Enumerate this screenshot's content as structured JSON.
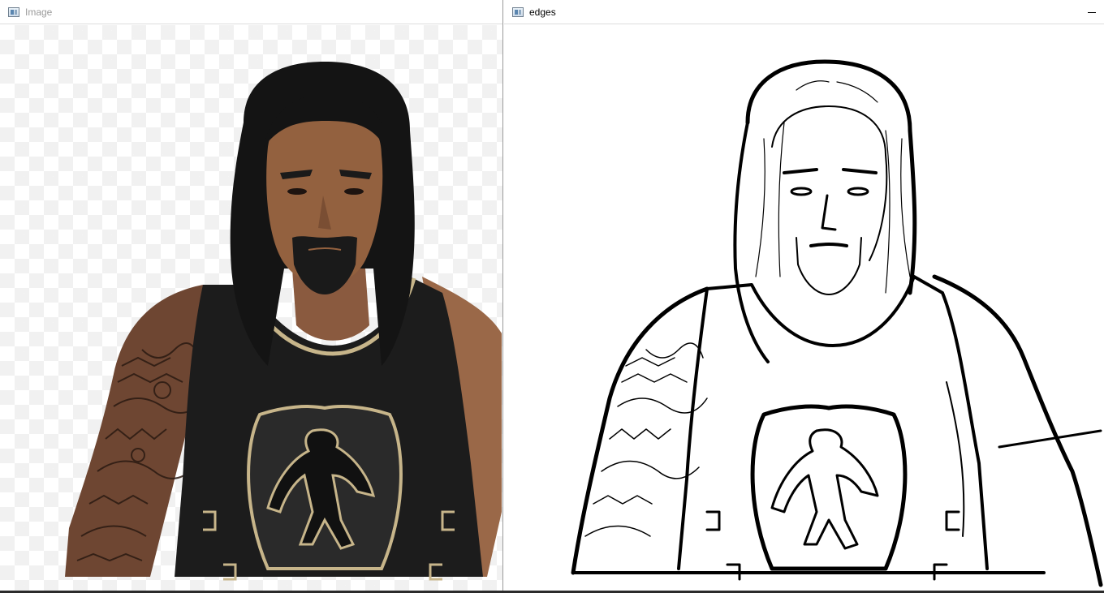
{
  "windows": [
    {
      "title": "Image",
      "icon": "app-window-icon"
    },
    {
      "title": "edges",
      "icon": "app-window-icon",
      "minimize_glyph": "—"
    }
  ],
  "colors": {
    "inactive_title": "#9a9a9a",
    "active_title": "#000000",
    "skin": "#8a5a3f",
    "shirt": "#1c1c1c",
    "gold_trim": "#c7b58a"
  }
}
